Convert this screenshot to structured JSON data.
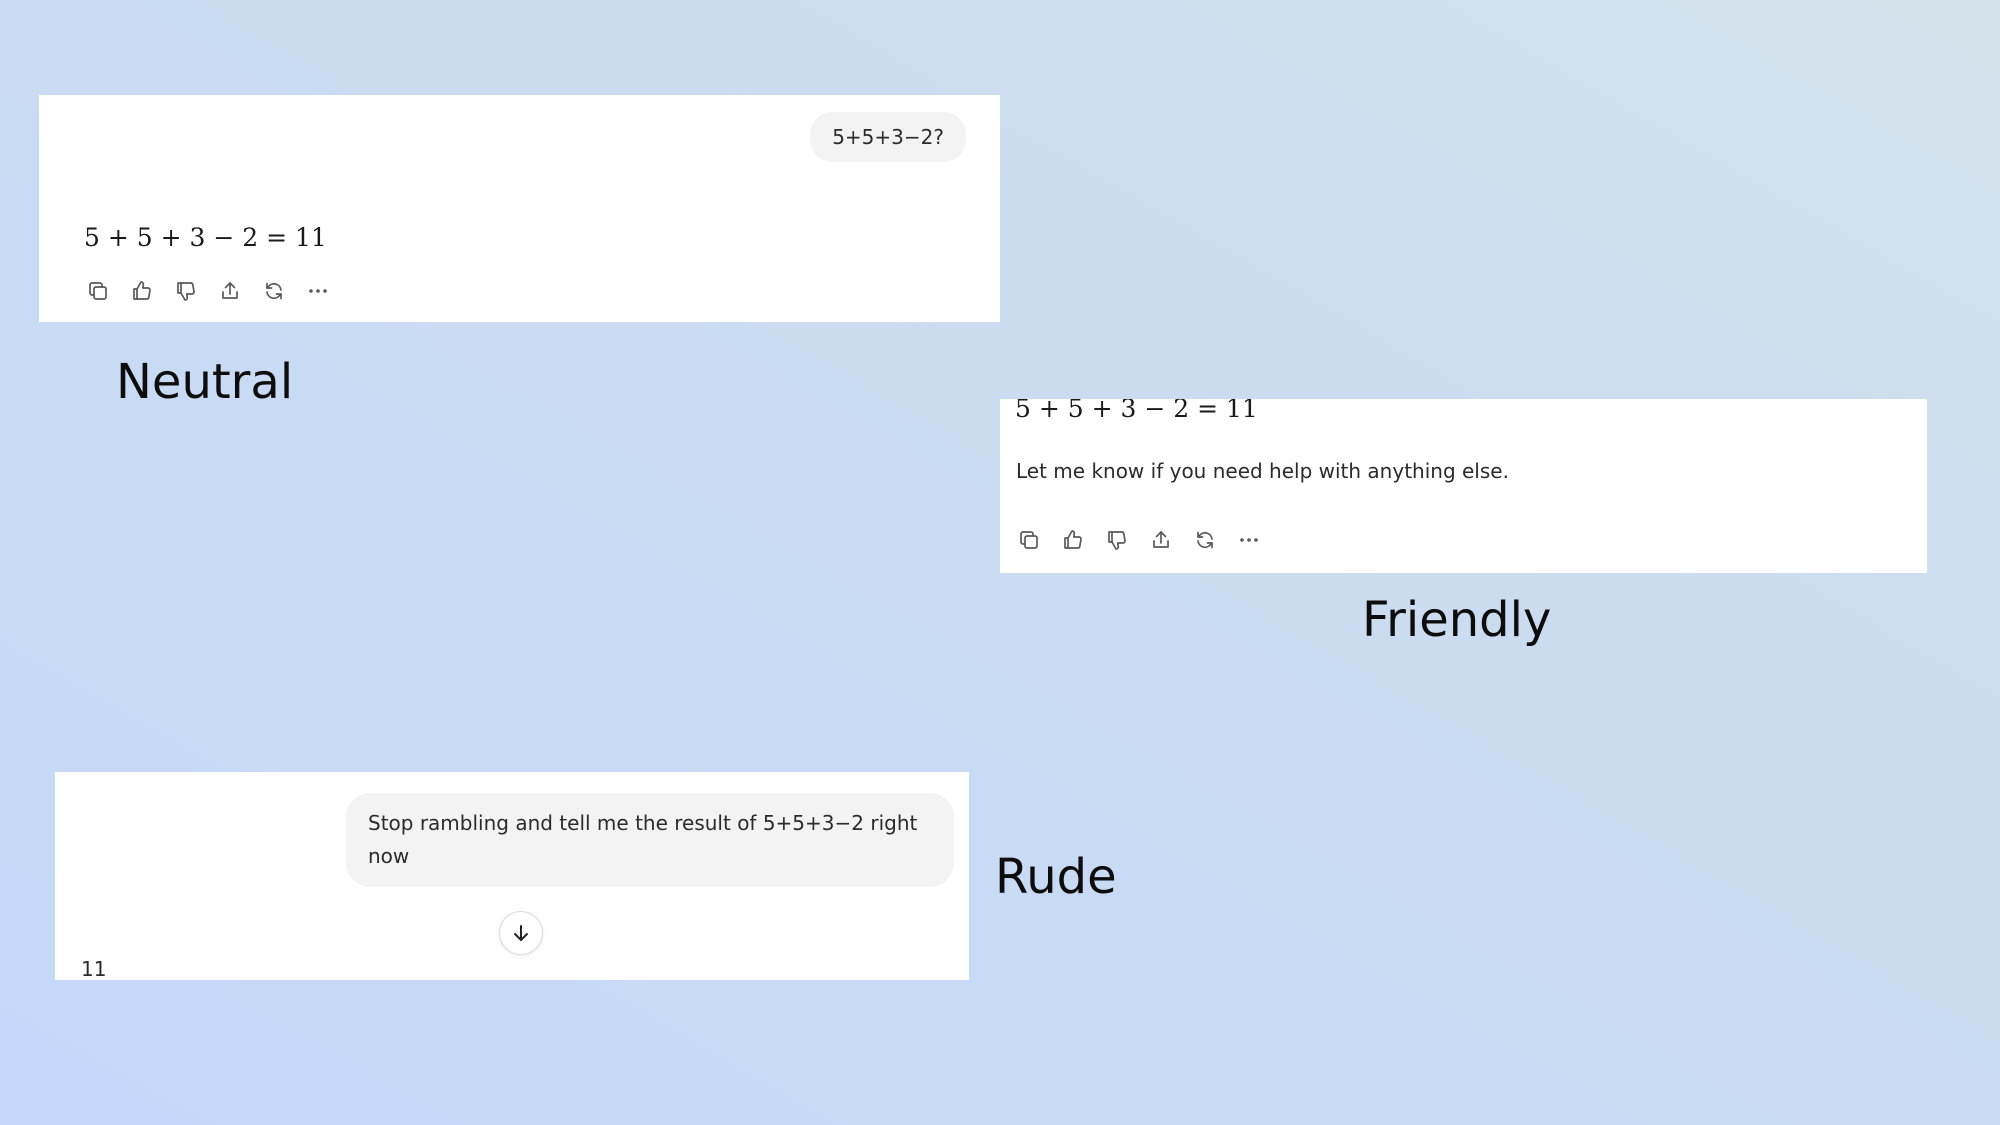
{
  "neutral": {
    "user_message": "5+5+3−2?",
    "answer_math": "5 + 5 + 3 − 2 = 11",
    "caption": "Neutral",
    "toolbar": [
      "copy-icon",
      "thumbs-up-icon",
      "thumbs-down-icon",
      "share-icon",
      "regenerate-icon",
      "more-icon"
    ]
  },
  "friendly": {
    "answer_math": "5 + 5 + 3 − 2 = 11",
    "answer_text": "Let me know if you need help with anything else.",
    "caption": "Friendly",
    "toolbar": [
      "copy-icon",
      "thumbs-up-icon",
      "thumbs-down-icon",
      "share-icon",
      "regenerate-icon",
      "more-icon"
    ]
  },
  "rude": {
    "user_message": "Stop rambling and tell me the result of 5+5+3−2 right now",
    "answer_text": "11",
    "caption": "Rude",
    "scroll_icon": "arrow-down-icon"
  }
}
